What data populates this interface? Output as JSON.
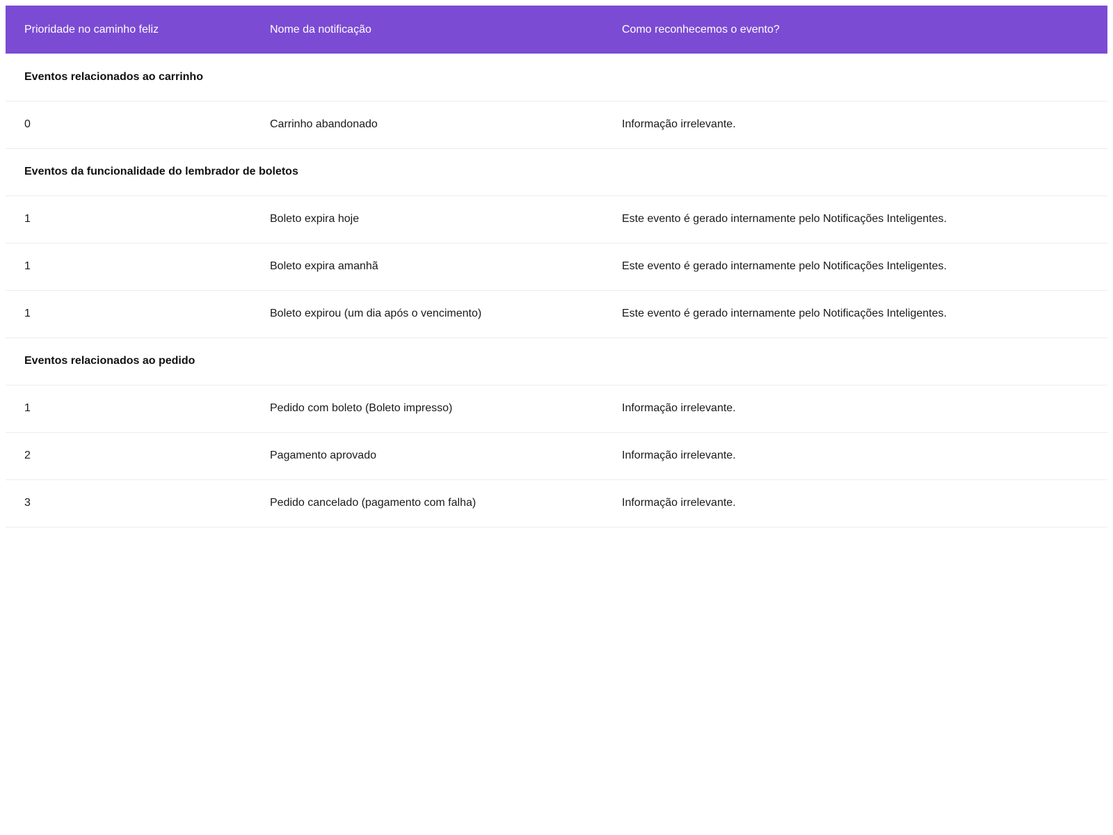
{
  "colors": {
    "header_bg": "#7b4bd4",
    "header_text": "#ffffff",
    "row_divider": "#ececec"
  },
  "table": {
    "headers": [
      "Prioridade no caminho feliz",
      "Nome da notificação",
      "Como reconhecemos o evento?"
    ],
    "groups": [
      {
        "title": "Eventos relacionados ao carrinho",
        "rows": [
          [
            "0",
            "Carrinho abandonado",
            "Informação irrelevante."
          ]
        ]
      },
      {
        "title": "Eventos da funcionalidade do lembrador de boletos",
        "rows": [
          [
            "1",
            "Boleto expira hoje",
            "Este evento é gerado internamente pelo Notificações Inteligentes."
          ],
          [
            "1",
            "Boleto expira amanhã",
            "Este evento é gerado internamente pelo Notificações Inteligentes."
          ],
          [
            "1",
            "Boleto expirou (um dia após o vencimento)",
            "Este evento é gerado internamente pelo Notificações Inteligentes."
          ]
        ]
      },
      {
        "title": "Eventos relacionados ao pedido",
        "rows": [
          [
            "1",
            "Pedido com boleto (Boleto impresso)",
            "Informação irrelevante."
          ],
          [
            "2",
            "Pagamento aprovado",
            "Informação irrelevante."
          ],
          [
            "3",
            "Pedido cancelado (pagamento com falha)",
            "Informação irrelevante."
          ]
        ]
      }
    ]
  }
}
